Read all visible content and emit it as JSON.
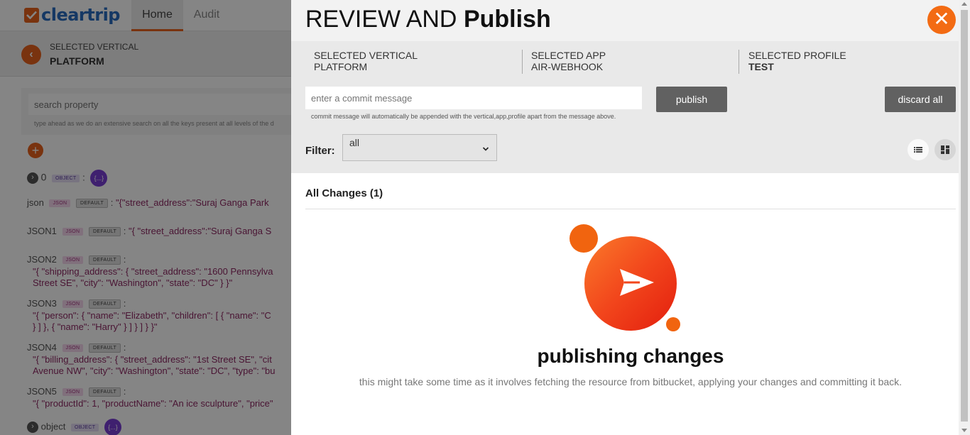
{
  "app": {
    "logo_text": "cleartrip",
    "nav": {
      "home": "Home",
      "audit": "Audit"
    },
    "vertical_label": "SELECTED VERTICAL",
    "vertical_value": "PLATFORM",
    "search": {
      "placeholder": "search property",
      "hint": "type ahead as we do an extensive search on all the keys present at all levels of the d"
    },
    "add_label": "+",
    "root_row": {
      "key": "0",
      "type_tag": "OBJECT",
      "badge": "{...}"
    },
    "properties": [
      {
        "key": "json",
        "type": "JSON",
        "tag": "DEFAULT",
        "value": "\"{\"street_address\":\"Suraj Ganga Park"
      },
      {
        "key": "JSON1",
        "type": "JSON",
        "tag": "DEFAULT",
        "value": "\"{ \"street_address\":\"Suraj Ganga S"
      },
      {
        "key": "JSON2",
        "type": "JSON",
        "tag": "DEFAULT",
        "lines": [
          "\"{ \"shipping_address\": { \"street_address\": \"1600 Pennsylva",
          "Street SE\", \"city\": \"Washington\", \"state\": \"DC\" } }\""
        ]
      },
      {
        "key": "JSON3",
        "type": "JSON",
        "tag": "DEFAULT",
        "lines": [
          "\"{ \"person\": { \"name\": \"Elizabeth\", \"children\": [ { \"name\": \"C",
          "} ] }, { \"name\": \"Harry\" } ] } ] } }\""
        ]
      },
      {
        "key": "JSON4",
        "type": "JSON",
        "tag": "DEFAULT",
        "lines": [
          "\"{ \"billing_address\": { \"street_address\": \"1st Street SE\", \"cit",
          "Avenue NW\", \"city\": \"Washington\", \"state\": \"DC\", \"type\": \"bu"
        ]
      },
      {
        "key": "JSON5",
        "type": "JSON",
        "tag": "DEFAULT",
        "lines": [
          "\"{ \"productId\": 1, \"productName\": \"An ice sculpture\", \"price\""
        ]
      }
    ],
    "last_row": {
      "key": "object",
      "type_tag": "OBJECT",
      "badge": "{...}"
    }
  },
  "modal": {
    "title_light": "REVIEW AND ",
    "title_bold": "Publish",
    "close_label": "✕",
    "selected_vertical": {
      "label": "SELECTED VERTICAL",
      "value": "PLATFORM"
    },
    "selected_app": {
      "label": "SELECTED APP",
      "value": "AIR-WEBHOOK"
    },
    "selected_profile": {
      "label": "SELECTED PROFILE",
      "value": "TEST"
    },
    "commit": {
      "placeholder": "enter a commit message",
      "note": "commit message will automatically be appended with the vertical,app,profile apart from the message above."
    },
    "publish_label": "publish",
    "discard_label": "discard all",
    "filter": {
      "label": "Filter:",
      "selected": "all"
    },
    "changes_title": "All Changes (1)",
    "publishing": {
      "title": "publishing changes",
      "subtitle": "this might take some time as it involves fetching the resource from bitbucket, applying your changes and committing it back."
    }
  },
  "colors": {
    "accent": "#f36b13",
    "button_gray": "#616161",
    "brand_blue": "#2a6cc0",
    "purple": "#7a3ed5"
  },
  "icons": [
    "cleartrip-logo-icon",
    "back-chevron-icon",
    "add-icon",
    "close-icon",
    "chevron-down-icon",
    "list-view-icon",
    "grid-view-icon",
    "send-icon"
  ]
}
